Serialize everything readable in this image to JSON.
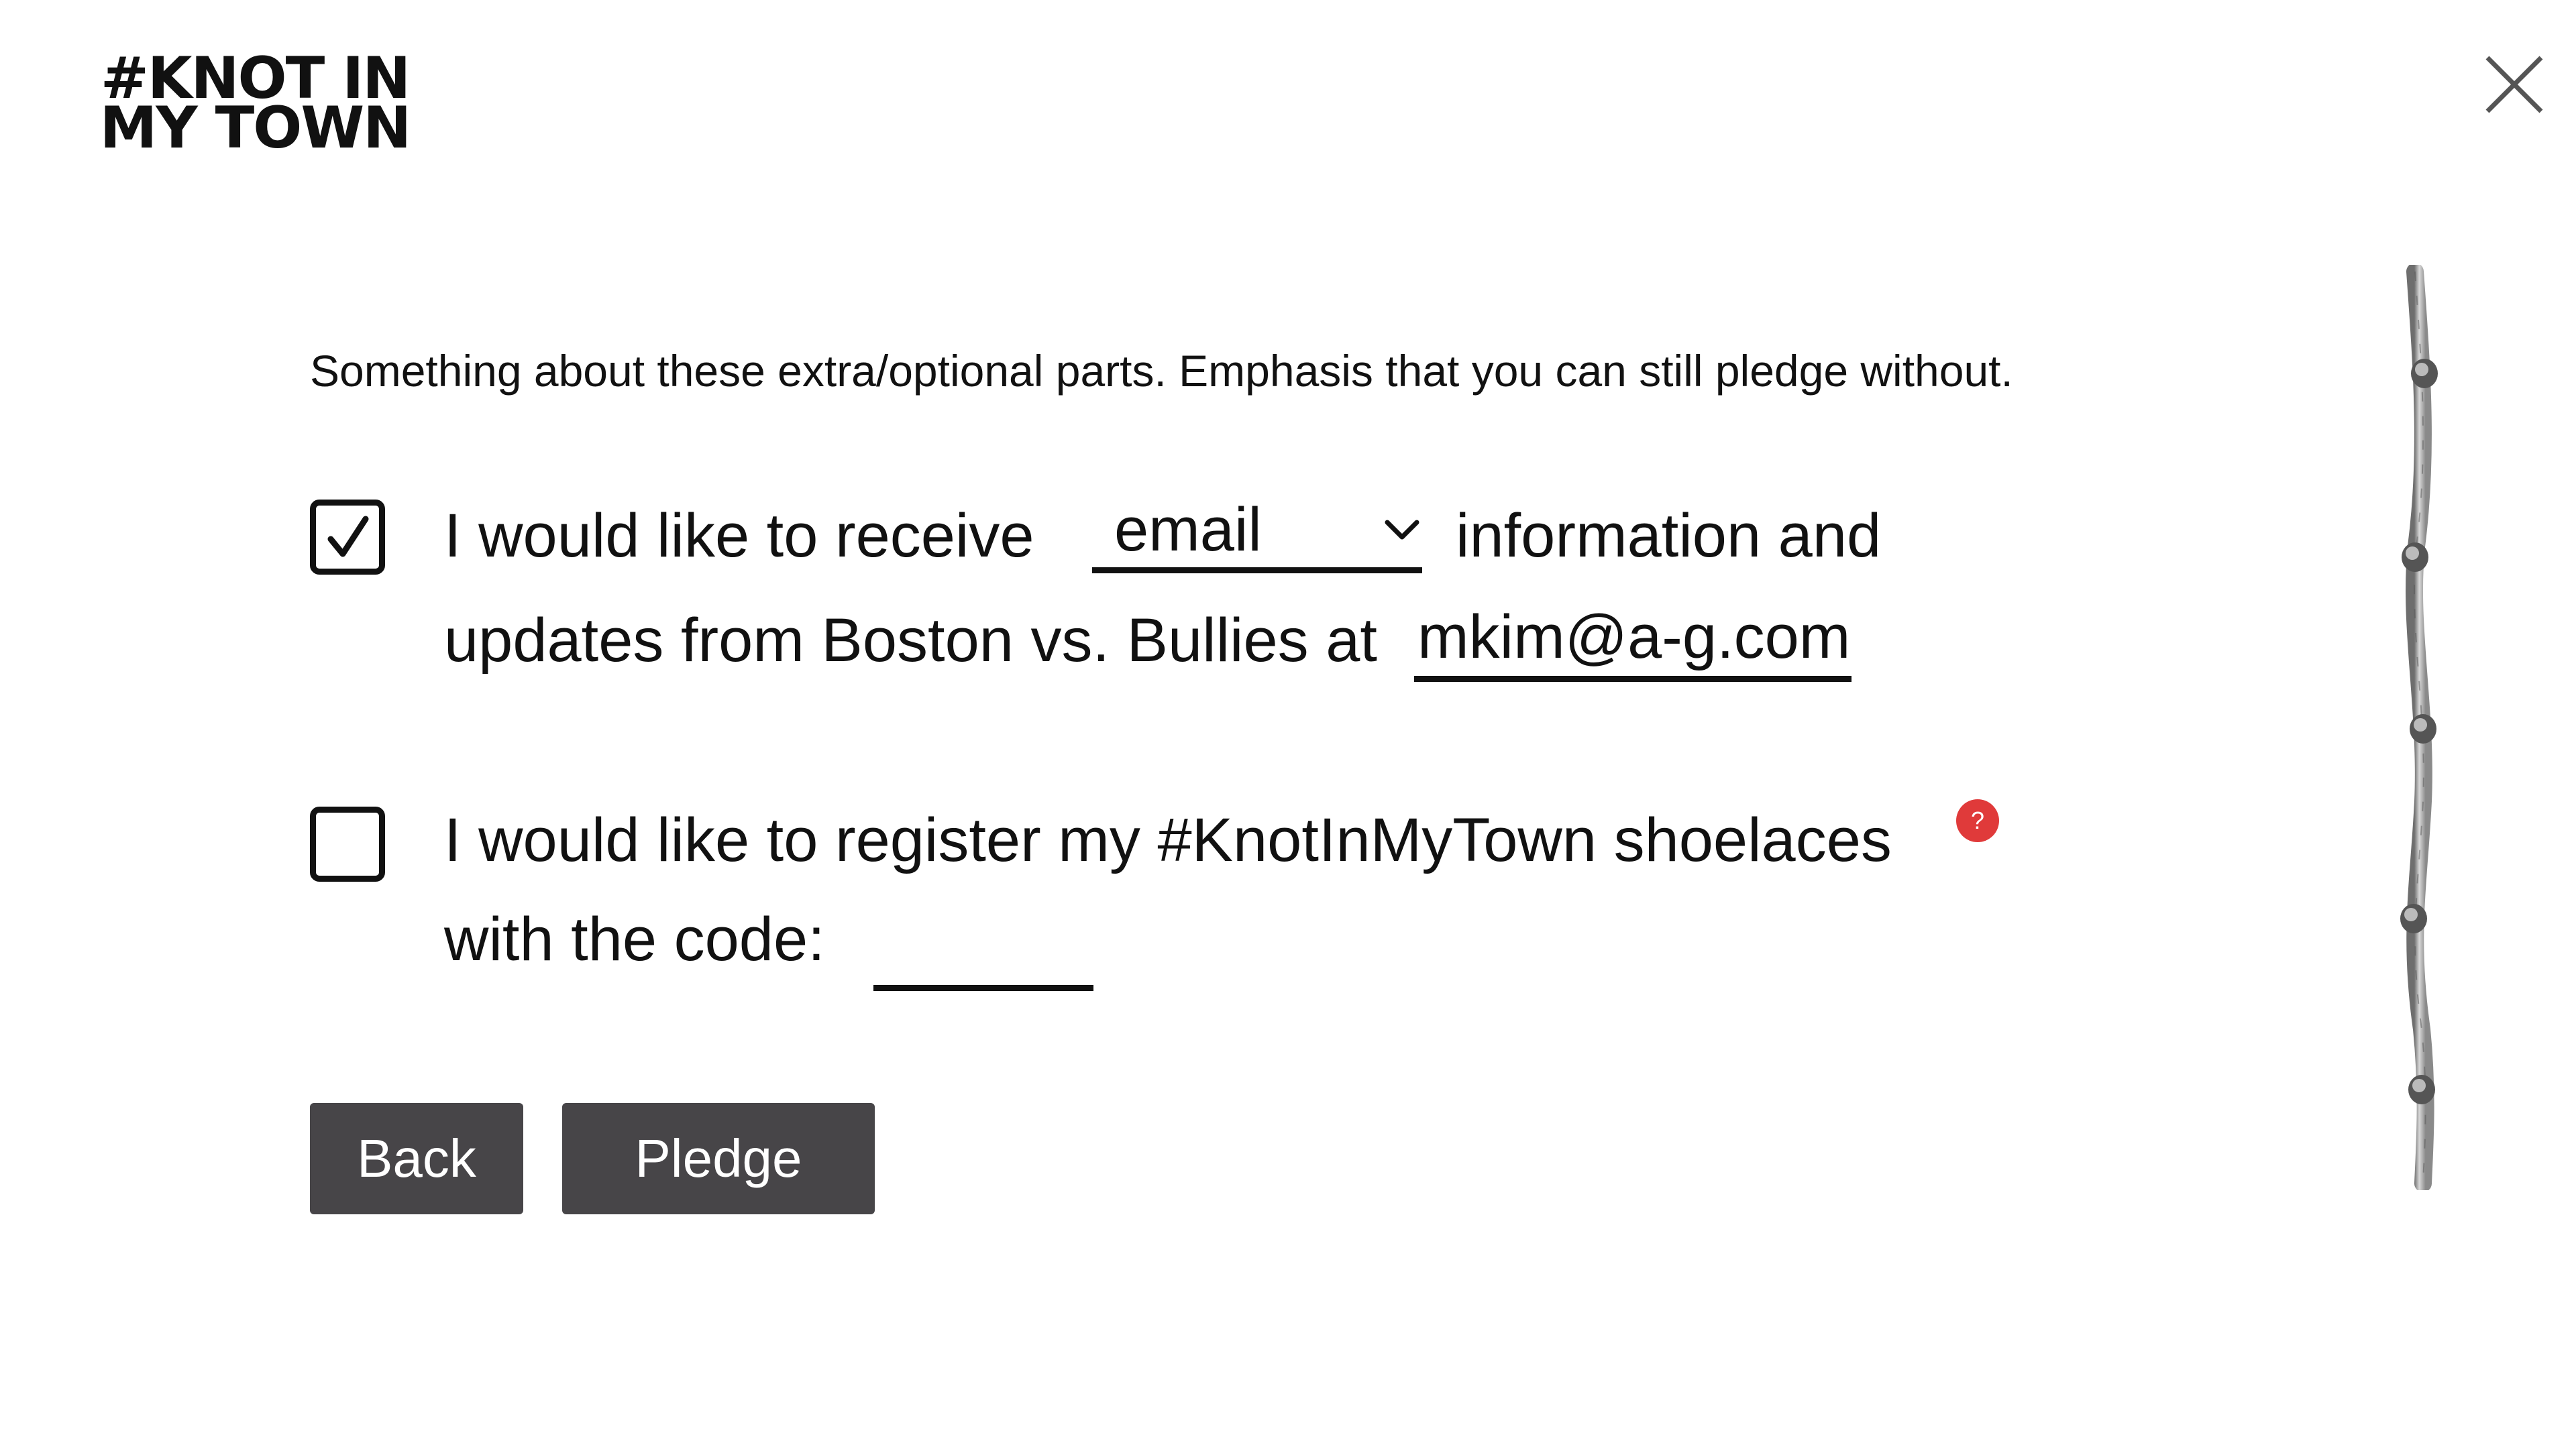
{
  "logo": {
    "line1": "#KNOT IN",
    "line2": "MY TOWN"
  },
  "close_icon": "close-icon",
  "intro_text": "Something about these extra/optional parts. Emphasis that you can still pledge without.",
  "option1": {
    "checked": true,
    "text_before": "I would like to receive",
    "select_value": "email",
    "text_after": "information and",
    "line2_text": "updates from Boston vs. Bullies at",
    "email_value": "mkim@a-g.com"
  },
  "option2": {
    "checked": false,
    "text_line1": "I would like to register my #KnotInMyTown shoelaces",
    "help_label": "?",
    "text_line2": "with the code:",
    "code_value": ""
  },
  "buttons": {
    "back": "Back",
    "pledge": "Pledge"
  },
  "colors": {
    "button_bg": "#474548",
    "help_badge": "#e03a3a",
    "text": "#111111"
  }
}
